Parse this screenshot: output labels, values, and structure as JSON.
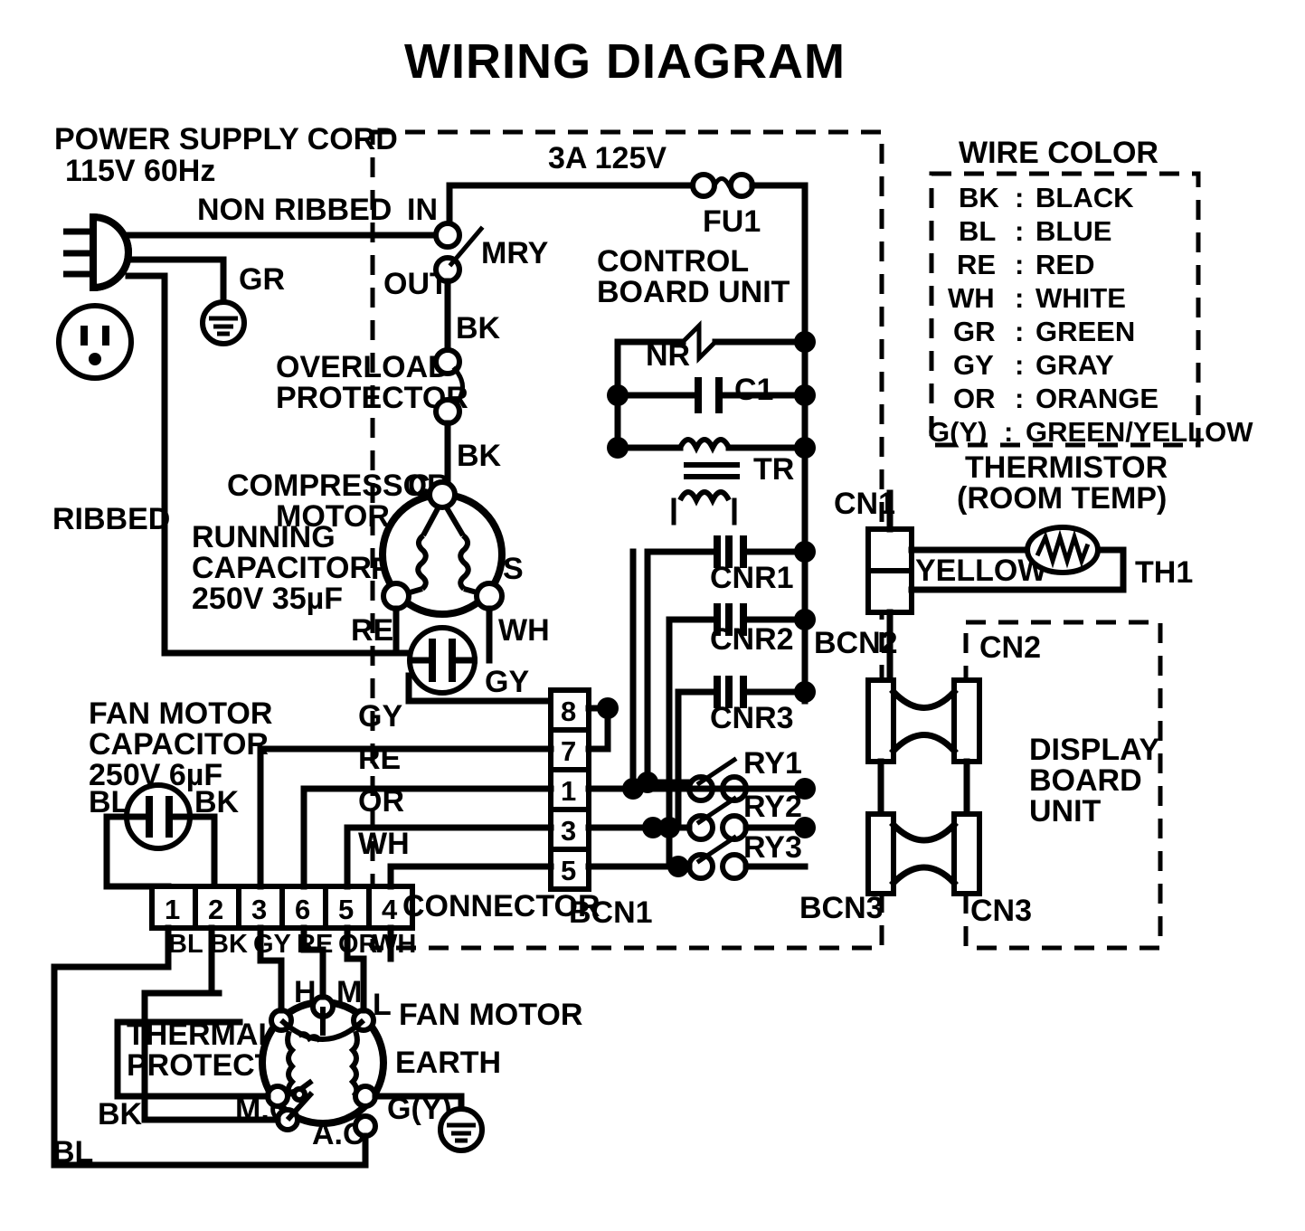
{
  "title": "WIRING DIAGRAM",
  "power_supply": {
    "label_line1": "POWER SUPPLY CORD",
    "label_line2": "115V 60Hz",
    "non_ribbed": "NON RIBBED",
    "ribbed": "RIBBED",
    "ground_label": "GR"
  },
  "control_board": {
    "title_line1": "CONTROL",
    "title_line2": "BOARD UNIT",
    "fuse_rating": "3A 125V",
    "fuse_label": "FU1",
    "varistor_label": "NR",
    "capacitor_label": "C1",
    "transformer_label": "TR",
    "switch_in": "IN",
    "switch_out": "OUT",
    "switch_label": "MRY",
    "connector_label": "BCN1",
    "connector2_label": "BCN2",
    "connector3_label": "BCN3",
    "relay_coils": [
      "CNR1",
      "CNR2",
      "CNR3"
    ],
    "relay_contacts": [
      "RY1",
      "RY2",
      "RY3"
    ],
    "terminal_pins": [
      "8",
      "7",
      "1",
      "3",
      "5"
    ]
  },
  "overload_protector": {
    "label_line1": "OVERLOAD",
    "label_line2": "PROTECTOR",
    "wire_top": "BK",
    "wire_bottom": "BK"
  },
  "compressor": {
    "label_line1": "COMPRESSOR",
    "label_line2": "MOTOR",
    "terminal_c": "C",
    "terminal_r": "R",
    "terminal_s": "S",
    "wire_re": "RE",
    "wire_wh": "WH",
    "wire_gy": "GY"
  },
  "running_capacitor": {
    "label_line1": "RUNNING",
    "label_line2": "CAPACITOR",
    "rating": "250V 35µF"
  },
  "fan_motor_capacitor": {
    "label_line1": "FAN MOTOR",
    "label_line2": "CAPACITOR",
    "rating": "250V 6µF",
    "wire_left": "BL",
    "wire_right": "BK"
  },
  "connector": {
    "label": "CONNECTOR",
    "pins": [
      "1",
      "2",
      "3",
      "6",
      "5",
      "4"
    ],
    "wire_colors": [
      "BL",
      "BK",
      "GY",
      "RE",
      "OR",
      "WH"
    ],
    "bus_labels": [
      "GY",
      "RE",
      "OR",
      "WH"
    ],
    "top_bus_label": "GY"
  },
  "fan_motor": {
    "label": "FAN MOTOR",
    "thermal_protector_line1": "THERMAL",
    "thermal_protector_line2": "PROTECTOR",
    "terminal_h": "H",
    "terminal_m": "M",
    "terminal_l": "L",
    "terminal_mc": "M.C",
    "terminal_ac": "A.C",
    "earth_label": "EARTH",
    "earth_wire": "G(Y)",
    "wire_bk": "BK",
    "wire_bl": "BL"
  },
  "thermistor": {
    "label_line1": "THERMISTOR",
    "label_line2": "(ROOM TEMP)",
    "connector_label": "CN1",
    "wire_color": "YELLOW",
    "device_label": "TH1"
  },
  "display_board": {
    "label_line1": "DISPLAY",
    "label_line2": "BOARD",
    "label_line3": "UNIT",
    "connector_top": "CN2",
    "connector_bottom": "CN3"
  },
  "wire_color_legend": {
    "title": "WIRE COLOR",
    "entries": [
      {
        "code": "BK",
        "name": "BLACK"
      },
      {
        "code": "BL",
        "name": "BLUE"
      },
      {
        "code": "RE",
        "name": "RED"
      },
      {
        "code": "WH",
        "name": "WHITE"
      },
      {
        "code": "GR",
        "name": "GREEN"
      },
      {
        "code": "GY",
        "name": "GRAY"
      },
      {
        "code": "OR",
        "name": "ORANGE"
      },
      {
        "code": "G(Y)",
        "name": "GREEN/YELLOW"
      }
    ]
  },
  "colors": {
    "line": "#000000",
    "background": "#ffffff"
  }
}
